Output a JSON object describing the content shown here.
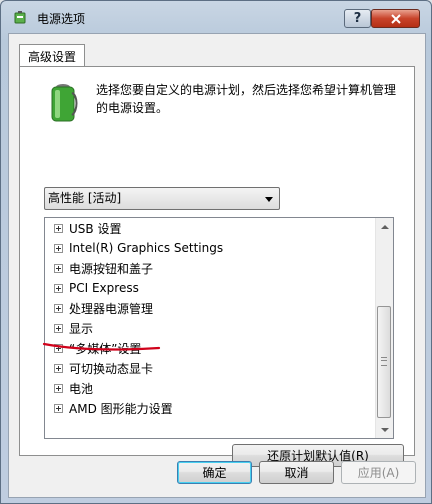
{
  "window": {
    "title": "电源选项",
    "help_label": "?"
  },
  "tabs": [
    {
      "label": "高级设置"
    }
  ],
  "description": "选择您要自定义的电源计划，然后选择您希望计算机管理的电源设置。",
  "plan_select": {
    "value": "高性能 [活动]"
  },
  "tree_items": [
    {
      "label": "USB 设置"
    },
    {
      "label": "Intel(R) Graphics Settings"
    },
    {
      "label": "电源按钮和盖子"
    },
    {
      "label": "PCI Express"
    },
    {
      "label": "处理器电源管理"
    },
    {
      "label": "显示"
    },
    {
      "label": "“多媒体”设置"
    },
    {
      "label": "可切换动态显卡"
    },
    {
      "label": "电池"
    },
    {
      "label": "AMD 图形能力设置"
    }
  ],
  "buttons": {
    "restore": "还原计划默认值(R)",
    "ok": "确定",
    "cancel": "取消",
    "apply": "应用(A)"
  },
  "colors": {
    "annotation": "#d0021b",
    "battery": "#3fa535"
  }
}
